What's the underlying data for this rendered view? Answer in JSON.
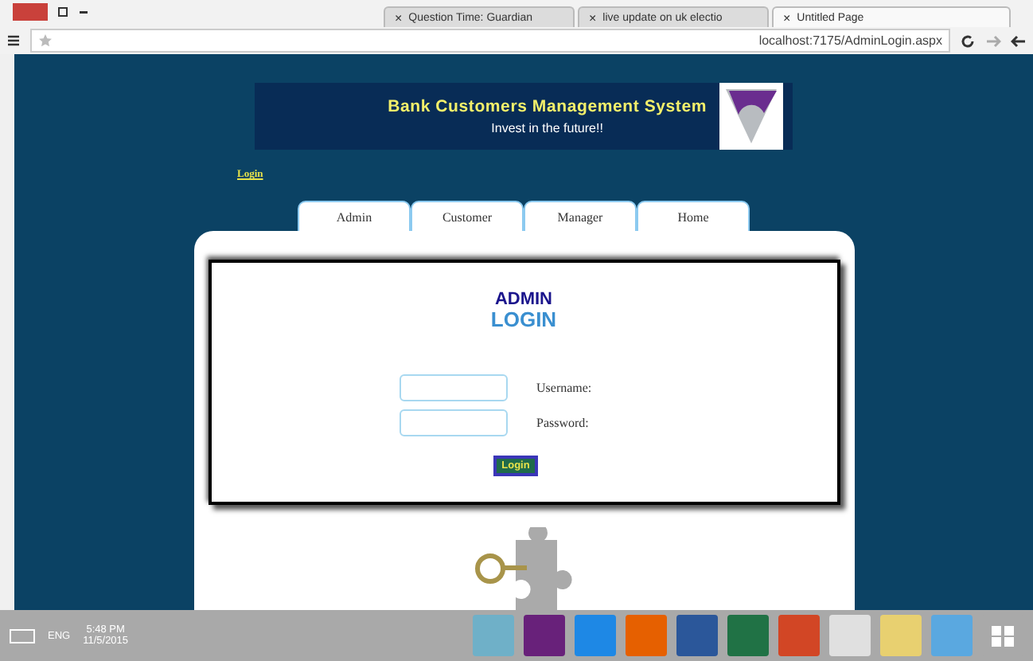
{
  "browser": {
    "tabs": [
      {
        "title": "Question Time: Guardian",
        "selected": false
      },
      {
        "title": "live update on uk electio",
        "selected": false
      },
      {
        "title": "Untitled Page",
        "selected": true
      }
    ],
    "close_tab": "×",
    "address": "localhost:7175/AdminLogin.aspx"
  },
  "banner": {
    "title": "Bank Customers Management System",
    "subtitle": "Invest in the future!!"
  },
  "login_link": "Login",
  "nav": [
    {
      "label": "Admin",
      "selected": false
    },
    {
      "label": "Customer",
      "selected": false
    },
    {
      "label": "Manager",
      "selected": false
    },
    {
      "label": "Home",
      "selected": false
    }
  ],
  "form": {
    "logo_top": "ADMIN",
    "logo_bottom": "LOGIN",
    "fields": [
      {
        "label": "Username:"
      },
      {
        "label": "Password:"
      }
    ],
    "button": "Login"
  },
  "taskbar": {
    "language": "ENG",
    "time": "5:48 PM",
    "date": "11/5/2015"
  }
}
